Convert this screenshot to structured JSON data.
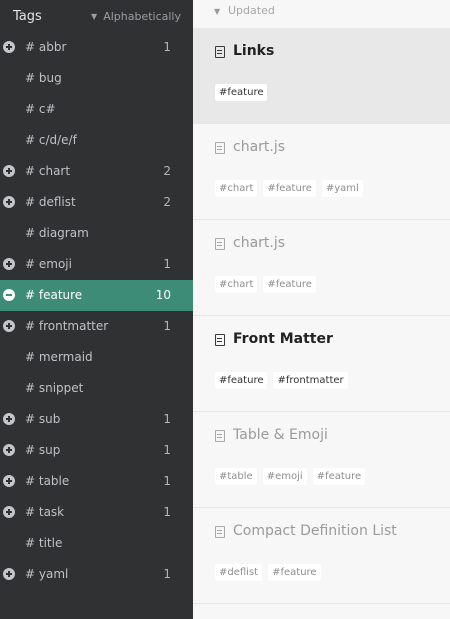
{
  "sidebar": {
    "title": "Tags",
    "sort_label": "Alphabetically",
    "tags": [
      {
        "name": "# abbr",
        "count": "1",
        "toggle": "plus"
      },
      {
        "name": "# bug",
        "count": "",
        "toggle": ""
      },
      {
        "name": "# c#",
        "count": "",
        "toggle": ""
      },
      {
        "name": "# c/d/e/f",
        "count": "",
        "toggle": ""
      },
      {
        "name": "# chart",
        "count": "2",
        "toggle": "plus"
      },
      {
        "name": "# deflist",
        "count": "2",
        "toggle": "plus"
      },
      {
        "name": "# diagram",
        "count": "",
        "toggle": ""
      },
      {
        "name": "# emoji",
        "count": "1",
        "toggle": "plus"
      },
      {
        "name": "# feature",
        "count": "10",
        "toggle": "minus",
        "active": true
      },
      {
        "name": "# frontmatter",
        "count": "1",
        "toggle": "plus"
      },
      {
        "name": "# mermaid",
        "count": "",
        "toggle": ""
      },
      {
        "name": "# snippet",
        "count": "",
        "toggle": ""
      },
      {
        "name": "# sub",
        "count": "1",
        "toggle": "plus"
      },
      {
        "name": "# sup",
        "count": "1",
        "toggle": "plus"
      },
      {
        "name": "# table",
        "count": "1",
        "toggle": "plus"
      },
      {
        "name": "# task",
        "count": "1",
        "toggle": "plus"
      },
      {
        "name": "# title",
        "count": "",
        "toggle": ""
      },
      {
        "name": "# yaml",
        "count": "1",
        "toggle": "plus"
      }
    ]
  },
  "main": {
    "sort_label": "Updated",
    "notes": [
      {
        "title": "Links",
        "bold": true,
        "selected": true,
        "tags": [
          "#feature"
        ]
      },
      {
        "title": "chart.js",
        "bold": false,
        "selected": false,
        "tags": [
          "#chart",
          "#feature",
          "#yaml"
        ]
      },
      {
        "title": "chart.js",
        "bold": false,
        "selected": false,
        "tags": [
          "#chart",
          "#feature"
        ]
      },
      {
        "title": "Front Matter",
        "bold": true,
        "selected": false,
        "tags": [
          "#feature",
          "#frontmatter"
        ]
      },
      {
        "title": "Table & Emoji",
        "bold": false,
        "selected": false,
        "tags": [
          "#table",
          "#emoji",
          "#feature"
        ]
      },
      {
        "title": "Compact Definition List",
        "bold": false,
        "selected": false,
        "tags": [
          "#deflist",
          "#feature"
        ]
      }
    ]
  },
  "colors": {
    "sidebar_bg": "#2f3133",
    "active_tag_bg": "#3d8c78"
  }
}
